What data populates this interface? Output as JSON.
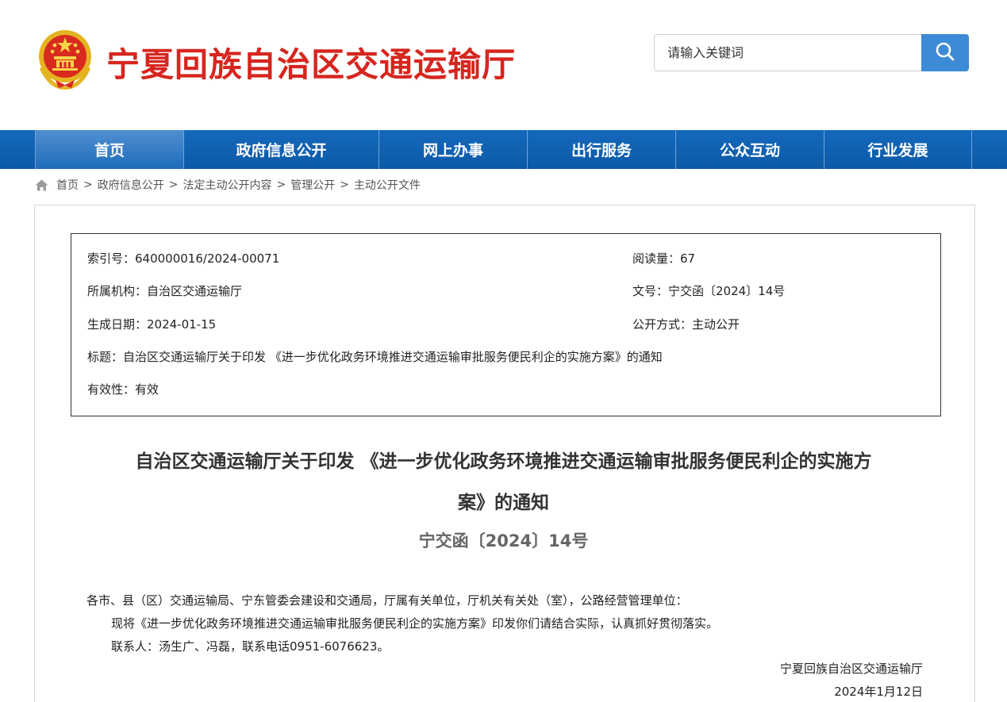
{
  "header": {
    "site_title": "宁夏回族自治区交通运输厅",
    "search_placeholder": "请输入关键词",
    "search_button_color": "#3d8bd6",
    "title_color": "#d6261f"
  },
  "nav": {
    "items": [
      {
        "label": "首页",
        "active": true
      },
      {
        "label": "政府信息公开"
      },
      {
        "label": "网上办事"
      },
      {
        "label": "出行服务"
      },
      {
        "label": "公众互动"
      },
      {
        "label": "行业发展"
      }
    ]
  },
  "breadcrumb": {
    "items": [
      "首页",
      "政府信息公开",
      "法定主动公开内容",
      "管理公开",
      "主动公开文件"
    ],
    "separator": ">"
  },
  "meta": {
    "index_no": "索引号：640000016/2024-00071",
    "views": "阅读量：67",
    "org": "所属机构：自治区交通运输厅",
    "doc_no": "文号：宁交函〔2024〕14号",
    "date": "生成日期：2024-01-15",
    "disclosure": "公开方式：主动公开",
    "title": "标题：自治区交通运输厅关于印发 《进一步优化政务环境推进交通运输审批服务便民利企的实施方案》的通知",
    "validity": "有效性：有效"
  },
  "document": {
    "title_line1": "自治区交通运输厅关于印发 《进一步优化政务环境推进交通运输审批服务便民利企的实施方",
    "title_line2": "案》的通知",
    "number": "宁交函〔2024〕14号",
    "salutation": "各市、县（区）交通运输局、宁东管委会建设和交通局，厅属有关单位，厅机关有关处（室），公路经营管理单位：",
    "paragraph1": "现将《进一步优化政务环境推进交通运输审批服务便民利企的实施方案》印发你们请结合实际，认真抓好贯彻落实。",
    "contact": "联系人：汤生广、冯磊，联系电话0951-6076623。",
    "signature": "宁夏回族自治区交通运输厅",
    "sign_date": "2024年1月12日"
  }
}
